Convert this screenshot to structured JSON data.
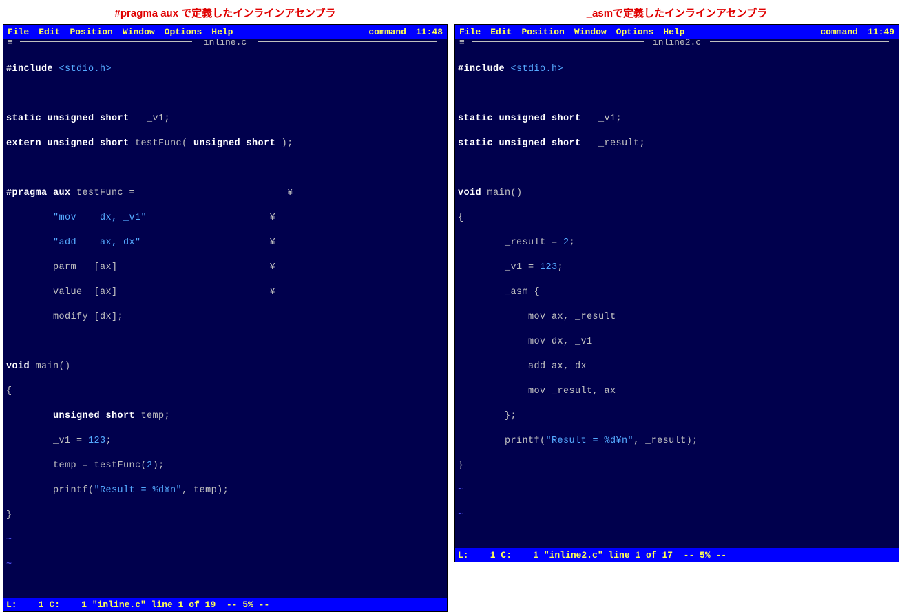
{
  "left": {
    "caption": "#pragma aux で定義したインラインアセンブラ",
    "menu": [
      "File",
      "Edit",
      "Position",
      "Window",
      "Options",
      "Help"
    ],
    "mode": "command",
    "clock": "11:48",
    "filename": "inline.c",
    "status": "L:    1 C:    1 \"inline.c\" line 1 of 19  -- 5% --",
    "code": {
      "l1a": "#include",
      "l1b": " <stdio.h>",
      "l3a": "static unsigned short",
      "l3b": "   _v1;",
      "l4a": "extern unsigned short",
      "l4b": " testFunc( ",
      "l4c": "unsigned short",
      "l4d": " );",
      "l6a": "#pragma aux",
      "l6b": " testFunc =                          ",
      "l6yen": "¥",
      "l7a": "        ",
      "l7b": "\"mov    dx, _v1\"",
      "l7c": "                     ",
      "l7yen": "¥",
      "l8a": "        ",
      "l8b": "\"add    ax, dx\"",
      "l8c": "                      ",
      "l8yen": "¥",
      "l9a": "        parm   [ax]                          ",
      "l9yen": "¥",
      "l10a": "        value  [ax]                          ",
      "l10yen": "¥",
      "l11": "        modify [dx];",
      "l13a": "void",
      "l13b": " main()",
      "l14": "{",
      "l15a": "        ",
      "l15b": "unsigned short",
      "l15c": " temp;",
      "l16a": "        _v1 = ",
      "l16b": "123",
      "l16c": ";",
      "l17a": "        temp = testFunc(",
      "l17b": "2",
      "l17c": ");",
      "l18a": "        printf(",
      "l18b": "\"Result = %d¥n\"",
      "l18c": ", temp);",
      "l19": "}",
      "t1": "~",
      "t2": "~"
    }
  },
  "right": {
    "caption": "_asmで定義したインラインアセンブラ",
    "menu": [
      "File",
      "Edit",
      "Position",
      "Window",
      "Options",
      "Help"
    ],
    "mode": "command",
    "clock": "11:49",
    "filename": "inline2.c",
    "status": "L:    1 C:    1 \"inline2.c\" line 1 of 17  -- 5% --",
    "code": {
      "l1a": "#include",
      "l1b": " <stdio.h>",
      "l3a": "static unsigned short",
      "l3b": "   _v1;",
      "l4a": "static unsigned short",
      "l4b": "   _result;",
      "l6a": "void",
      "l6b": " main()",
      "l7": "{",
      "l8a": "        _result = ",
      "l8b": "2",
      "l8c": ";",
      "l9a": "        _v1 = ",
      "l9b": "123",
      "l9c": ";",
      "l10": "        _asm {",
      "l11": "            mov ax, _result",
      "l12": "            mov dx, _v1",
      "l13": "            add ax, dx",
      "l14": "            mov _result, ax",
      "l15": "        };",
      "l16a": "        printf(",
      "l16b": "\"Result = %d¥n\"",
      "l16c": ", _result);",
      "l17": "}",
      "t1": "~",
      "t2": "~"
    }
  }
}
